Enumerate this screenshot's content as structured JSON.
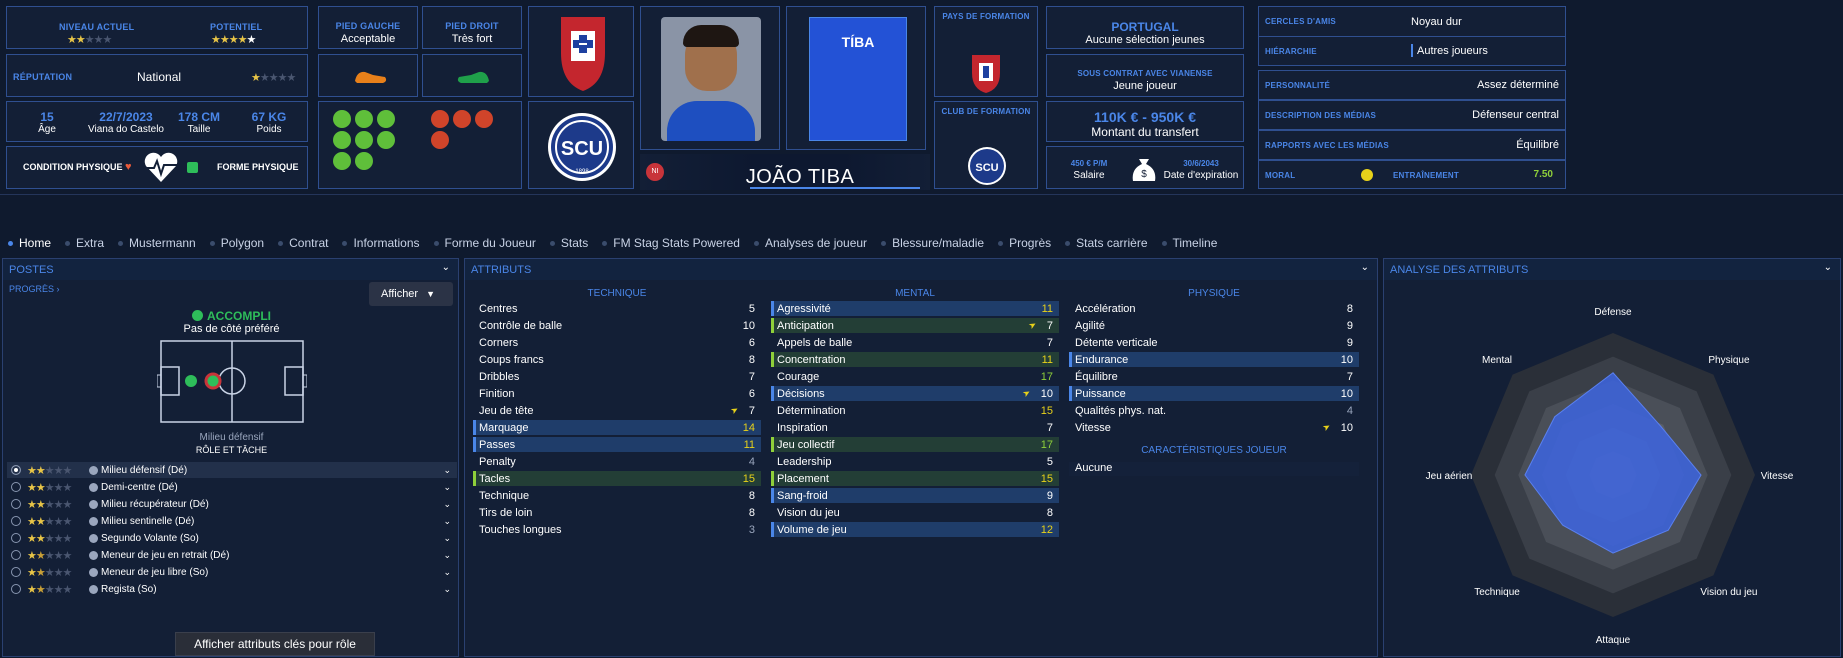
{
  "header": {
    "niveau_actuel_label": "NIVEAU ACTUEL",
    "potentiel_label": "POTENTIEL",
    "reputation_label": "RÉPUTATION",
    "reputation_value": "National",
    "age": "15",
    "age_label": "Âge",
    "birth": "22/7/2023",
    "birthplace": "Viana do Castelo",
    "height": "178 CM",
    "height_label": "Taille",
    "weight": "67 KG",
    "weight_label": "Poids",
    "condition_label": "CONDITION PHYSIQUE",
    "forme_label": "FORME PHYSIQUE",
    "pied_gauche_label": "PIED GAUCHE",
    "pied_gauche_value": "Acceptable",
    "pied_droit_label": "PIED DROIT",
    "pied_droit_value": "Très fort",
    "player_name": "JOÃO TIBA",
    "nat_badge": "NI",
    "shirt_name": "TÍBA",
    "pays_formation_label": "PAYS DE FORMATION",
    "club_formation_label": "CLUB DE FORMATION",
    "nation": "PORTUGAL",
    "nation_sub": "Aucune sélection jeunes",
    "contrat_label": "SOUS CONTRAT AVEC VIANENSE",
    "contrat_value": "Jeune joueur",
    "transfer_value": "110K € - 950K €",
    "transfer_label": "Montant du transfert",
    "salary": "450 € P/M",
    "salary_label": "Salaire",
    "expiry": "30/6/2043",
    "expiry_label": "Date d'expiration"
  },
  "club_logo_text": "SCU",
  "club_logo_year": "1898",
  "info": [
    {
      "label": "CERCLES D'AMIS",
      "value": "Noyau dur"
    },
    {
      "label": "HIÉRARCHIE",
      "value": "Autres joueurs"
    },
    {
      "label": "PERSONNALITÉ",
      "value": "Assez déterminé"
    },
    {
      "label": "DESCRIPTION DES MÉDIAS",
      "value": "Défenseur central"
    },
    {
      "label": "RAPPORTS AVEC LES MÉDIAS",
      "value": "Équilibré"
    }
  ],
  "moral_label": "MORAL",
  "training_label": "ENTRAÎNEMENT",
  "training_value": "7.50",
  "tabs": [
    "Home",
    "Extra",
    "Mustermann",
    "Polygon",
    "Contrat",
    "Informations",
    "Forme du Joueur",
    "Stats",
    "FM Stag Stats Powered",
    "Analyses de joueur",
    "Blessure/maladie",
    "Progrès",
    "Stats carrière",
    "Timeline"
  ],
  "postes": {
    "title": "POSTES",
    "progres": "PROGRÈS",
    "afficher": "Afficher",
    "status": "ACCOMPLI",
    "pref": "Pas de côté préféré",
    "pos_name": "Milieu défensif",
    "role_label": "RÔLE ET TÂCHE",
    "roles": [
      {
        "name": "Milieu défensif (Dé)",
        "stars": 2
      },
      {
        "name": "Demi-centre (Dé)",
        "stars": 2
      },
      {
        "name": "Milieu récupérateur (Dé)",
        "stars": 2
      },
      {
        "name": "Milieu sentinelle (Dé)",
        "stars": 2
      },
      {
        "name": "Segundo Volante (So)",
        "stars": 2
      },
      {
        "name": "Meneur de jeu en retrait (Dé)",
        "stars": 1.5
      },
      {
        "name": "Meneur de jeu libre (So)",
        "stars": 1.5
      },
      {
        "name": "Regista (So)",
        "stars": 1.5
      }
    ],
    "tooltip": "Afficher attributs clés pour rôle"
  },
  "attributes": {
    "title": "ATTRIBUTS",
    "technique_label": "TECHNIQUE",
    "mental_label": "MENTAL",
    "physique_label": "PHYSIQUE",
    "technique": [
      {
        "n": "Centres",
        "v": "5"
      },
      {
        "n": "Contrôle de balle",
        "v": "10"
      },
      {
        "n": "Corners",
        "v": "6"
      },
      {
        "n": "Coups francs",
        "v": "8"
      },
      {
        "n": "Dribbles",
        "v": "7"
      },
      {
        "n": "Finition",
        "v": "6"
      },
      {
        "n": "Jeu de tête",
        "v": "7"
      },
      {
        "n": "Marquage",
        "v": "14"
      },
      {
        "n": "Passes",
        "v": "11"
      },
      {
        "n": "Penalty",
        "v": "4"
      },
      {
        "n": "Tacles",
        "v": "15"
      },
      {
        "n": "Technique",
        "v": "8"
      },
      {
        "n": "Tirs de loin",
        "v": "8"
      },
      {
        "n": "Touches longues",
        "v": "3"
      }
    ],
    "mental": [
      {
        "n": "Agressivité",
        "v": "11"
      },
      {
        "n": "Anticipation",
        "v": "7"
      },
      {
        "n": "Appels de balle",
        "v": "7"
      },
      {
        "n": "Concentration",
        "v": "11"
      },
      {
        "n": "Courage",
        "v": "17"
      },
      {
        "n": "Décisions",
        "v": "10"
      },
      {
        "n": "Détermination",
        "v": "15"
      },
      {
        "n": "Inspiration",
        "v": "7"
      },
      {
        "n": "Jeu collectif",
        "v": "17"
      },
      {
        "n": "Leadership",
        "v": "5"
      },
      {
        "n": "Placement",
        "v": "15"
      },
      {
        "n": "Sang-froid",
        "v": "9"
      },
      {
        "n": "Vision du jeu",
        "v": "8"
      },
      {
        "n": "Volume de jeu",
        "v": "12"
      }
    ],
    "physique": [
      {
        "n": "Accélération",
        "v": "8"
      },
      {
        "n": "Agilité",
        "v": "9"
      },
      {
        "n": "Détente verticale",
        "v": "9"
      },
      {
        "n": "Endurance",
        "v": "10"
      },
      {
        "n": "Équilibre",
        "v": "7"
      },
      {
        "n": "Puissance",
        "v": "10"
      },
      {
        "n": "Qualités phys. nat.",
        "v": "4"
      },
      {
        "n": "Vitesse",
        "v": "10"
      }
    ],
    "traits_label": "CARACTÉRISTIQUES JOUEUR",
    "traits_value": "Aucune"
  },
  "analyse": {
    "title": "ANALYSE DES ATTRIBUTS",
    "axes": [
      "Défense",
      "Physique",
      "Vitesse",
      "Vision du jeu",
      "Attaque",
      "Technique",
      "Jeu aérien",
      "Mental"
    ],
    "values": [
      0.72,
      0.48,
      0.62,
      0.55,
      0.55,
      0.5,
      0.62,
      0.58
    ]
  },
  "colors": {
    "accent": "#4a86e8",
    "green": "#8fd03a",
    "gold": "#e8c547",
    "panel": "#131f36",
    "bg": "#0f1a2e"
  }
}
